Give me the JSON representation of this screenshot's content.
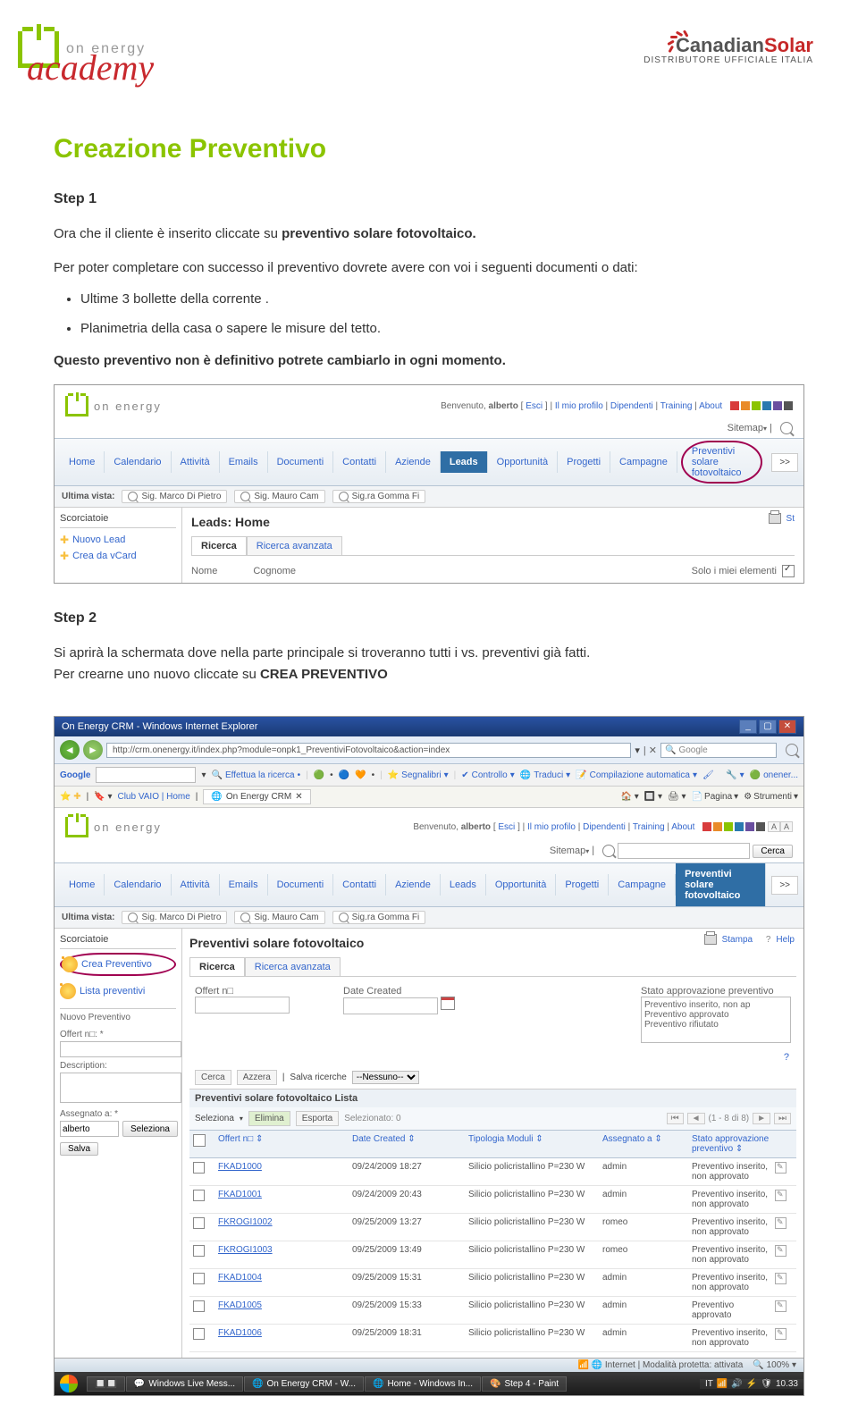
{
  "header": {
    "brand_left": "on energy",
    "academy": "academy",
    "brand_right_1": "Canadian",
    "brand_right_2": "Solar",
    "tagline": "DISTRIBUTORE UFFICIALE ITALIA"
  },
  "doc": {
    "title": "Creazione Preventivo",
    "step1_h": "Step 1",
    "step1_p1a": "Ora che il cliente è inserito cliccate su ",
    "step1_p1b": "preventivo solare fotovoltaico.",
    "step1_p2": "Per poter completare con successo il preventivo dovrete avere con voi i seguenti documenti o dati:",
    "bullet1": "Ultime 3 bollette della corrente .",
    "bullet2": "Planimetria della casa o sapere le misure del tetto.",
    "note": "Questo preventivo non è definitivo potrete cambiarlo in ogni momento.",
    "step2_h": "Step 2",
    "step2_p_a": "Si aprirà la schermata dove nella parte principale si troveranno tutti i vs. preventivi già fatti. ",
    "step2_p_b": "Per crearne uno nuovo cliccate su ",
    "step2_p_c": "CREA PREVENTIVO"
  },
  "crm": {
    "brand": "on energy",
    "welcome_a": "Benvenuto, ",
    "welcome_user": "alberto",
    "welcome_b": " [ ",
    "logout": "Esci",
    "welcome_c": " ]   ",
    "link_profile": "Il mio profilo",
    "link_dip": "Dipendenti",
    "link_train": "Training",
    "link_about": "About",
    "sitemap": "Sitemap",
    "search_btn": "Cerca",
    "nav": [
      "Home",
      "Calendario",
      "Attività",
      "Emails",
      "Documenti",
      "Contatti",
      "Aziende",
      "Leads",
      "Opportunità",
      "Progetti",
      "Campagne",
      "Preventivi solare fotovoltaico"
    ],
    "more": ">>",
    "recent_label": "Ultima vista:",
    "recent_items": [
      "Sig. Marco Di Pietro",
      "Sig. Mauro Cam",
      "Sig.ra Gomma Fi"
    ],
    "shortcuts": "Scorciatoie",
    "sc_new_lead": "Nuovo Lead",
    "sc_vcard": "Crea da vCard",
    "leads_home": "Leads: Home",
    "tab_search": "Ricerca",
    "tab_adv": "Ricerca avanzata",
    "col_nome": "Nome",
    "col_cognome": "Cognome",
    "only_mine": "Solo i miei elementi",
    "print": "St"
  },
  "browser": {
    "title": "On Energy CRM - Windows Internet Explorer",
    "url": "http://crm.onenergy.it/index.php?module=onpk1_PreventiviFotovoltaico&action=index",
    "searchprov": "Google",
    "google_label": "Google",
    "g_search": "Effettua la ricerca",
    "g_bookmarks": "Segnalibri",
    "g_check": "Controllo",
    "g_translate": "Traduci",
    "g_autofill": "Compilazione automatica",
    "g_user": "onener...",
    "fav_site": "Club VAIO | Home",
    "browsertab": "On Energy CRM",
    "tool_page": "Pagina",
    "tool_tools": "Strumenti",
    "status_left": "",
    "status_net": "Internet | Modalità protetta: attivata",
    "zoom": "100%"
  },
  "crm2": {
    "page_title": "Preventivi solare fotovoltaico",
    "sc_crea": "Crea Preventivo",
    "sc_lista": "Lista preventivi",
    "new_prev": "Nuovo Preventivo",
    "lbl_offert": "Offert n□: *",
    "lbl_desc": "Description:",
    "lbl_assign": "Assegnato a: *",
    "val_assign": "alberto",
    "btn_sel": "Seleziona",
    "btn_save": "Salva",
    "f_offert": "Offert n□",
    "f_date": "Date Created",
    "f_stato": "Stato approvazione preventivo",
    "statuses": [
      "Preventivo inserito, non ap",
      "Preventivo approvato",
      "Preventivo rifiutato"
    ],
    "act_cerca": "Cerca",
    "act_azzera": "Azzera",
    "act_salva": "Salva ricerche",
    "dd_none": "--Nessuno--",
    "list_title": "Preventivi solare fotovoltaico Lista",
    "sel_label": "Seleziona",
    "btn_del": "Elimina",
    "btn_exp": "Esporta",
    "sel_count_lbl": "Selezionato:",
    "sel_count": "0",
    "pager": "(1 - 8 di 8)",
    "cols": [
      "Offert n□ ⇕",
      "Date Created ⇕",
      "Tipologia Moduli ⇕",
      "Assegnato a ⇕",
      "Stato approvazione preventivo ⇕"
    ],
    "rows": [
      {
        "id": "FKAD1000",
        "date": "09/24/2009 18:27",
        "mod": "Silicio policristallino P=230 W",
        "asg": "admin",
        "stat": "Preventivo inserito, non approvato"
      },
      {
        "id": "FKAD1001",
        "date": "09/24/2009 20:43",
        "mod": "Silicio policristallino P=230 W",
        "asg": "admin",
        "stat": "Preventivo inserito, non approvato"
      },
      {
        "id": "FKROGI1002",
        "date": "09/25/2009 13:27",
        "mod": "Silicio policristallino P=230 W",
        "asg": "romeo",
        "stat": "Preventivo inserito, non approvato"
      },
      {
        "id": "FKROGI1003",
        "date": "09/25/2009 13:49",
        "mod": "Silicio policristallino P=230 W",
        "asg": "romeo",
        "stat": "Preventivo inserito, non approvato"
      },
      {
        "id": "FKAD1004",
        "date": "09/25/2009 15:31",
        "mod": "Silicio policristallino P=230 W",
        "asg": "admin",
        "stat": "Preventivo inserito, non approvato"
      },
      {
        "id": "FKAD1005",
        "date": "09/25/2009 15:33",
        "mod": "Silicio policristallino P=230 W",
        "asg": "admin",
        "stat": "Preventivo approvato"
      },
      {
        "id": "FKAD1006",
        "date": "09/25/2009 18:31",
        "mod": "Silicio policristallino P=230 W",
        "asg": "admin",
        "stat": "Preventivo inserito, non approvato"
      }
    ],
    "help": "Help",
    "stampa": "Stampa"
  },
  "taskbar": {
    "items": [
      "",
      "Windows Live Mess...",
      "On Energy CRM - W...",
      "Home - Windows In...",
      "Step 4 - Paint"
    ],
    "lang": "IT",
    "time": "10.33"
  }
}
